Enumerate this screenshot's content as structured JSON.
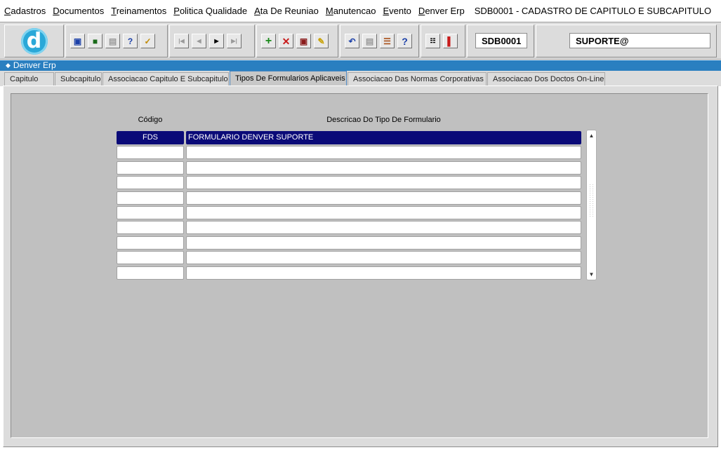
{
  "menu": {
    "items": [
      {
        "first": "C",
        "rest": "adastros"
      },
      {
        "first": "D",
        "rest": "ocumentos"
      },
      {
        "first": "T",
        "rest": "reinamentos"
      },
      {
        "first": "P",
        "rest": "olitica Qualidade"
      },
      {
        "first": "A",
        "rest": "ta De Reuniao"
      },
      {
        "first": "M",
        "rest": "anutencao"
      },
      {
        "first": "E",
        "rest": "vento"
      },
      {
        "first": "D",
        "rest": "enver Erp"
      }
    ],
    "title": "SDB0001 - CADASTRO DE CAPITULO E SUBCAPITULO"
  },
  "toolbar": {
    "logo_letter": "d",
    "form_code": "SDB0001",
    "user": "SUPORTE@",
    "icons": [
      "save-icon",
      "print-preview-icon",
      "print-icon",
      "query-icon",
      "execute-query-icon",
      "first-record-icon",
      "previous-record-icon",
      "next-record-icon",
      "last-record-icon",
      "insert-record-icon",
      "delete-record-icon",
      "find-icon",
      "clear-icon",
      "undo-icon",
      "paste-icon",
      "list-icon",
      "help-icon",
      "menu-icon",
      "exit-icon"
    ]
  },
  "window": {
    "title": "Denver Erp"
  },
  "tabs": [
    {
      "label": "Capitulo",
      "active": false
    },
    {
      "label": "Subcapitulo",
      "active": false
    },
    {
      "label": "Associacao Capitulo E Subcapitulo",
      "active": false
    },
    {
      "label": "Tipos De Formularios Aplicaveis",
      "active": true
    },
    {
      "label": "Associacao Das Normas Corporativas",
      "active": false
    },
    {
      "label": "Associacao Dos Doctos On-Line",
      "active": false
    }
  ],
  "grid": {
    "headers": {
      "code": "Código",
      "desc": "Descricao Do Tipo De Formulario"
    },
    "rows": [
      {
        "code": "FDS",
        "desc": "FORMULARIO DENVER SUPORTE"
      },
      {
        "code": "",
        "desc": ""
      },
      {
        "code": "",
        "desc": ""
      },
      {
        "code": "",
        "desc": ""
      },
      {
        "code": "",
        "desc": ""
      },
      {
        "code": "",
        "desc": ""
      },
      {
        "code": "",
        "desc": ""
      },
      {
        "code": "",
        "desc": ""
      },
      {
        "code": "",
        "desc": ""
      },
      {
        "code": "",
        "desc": ""
      }
    ]
  }
}
